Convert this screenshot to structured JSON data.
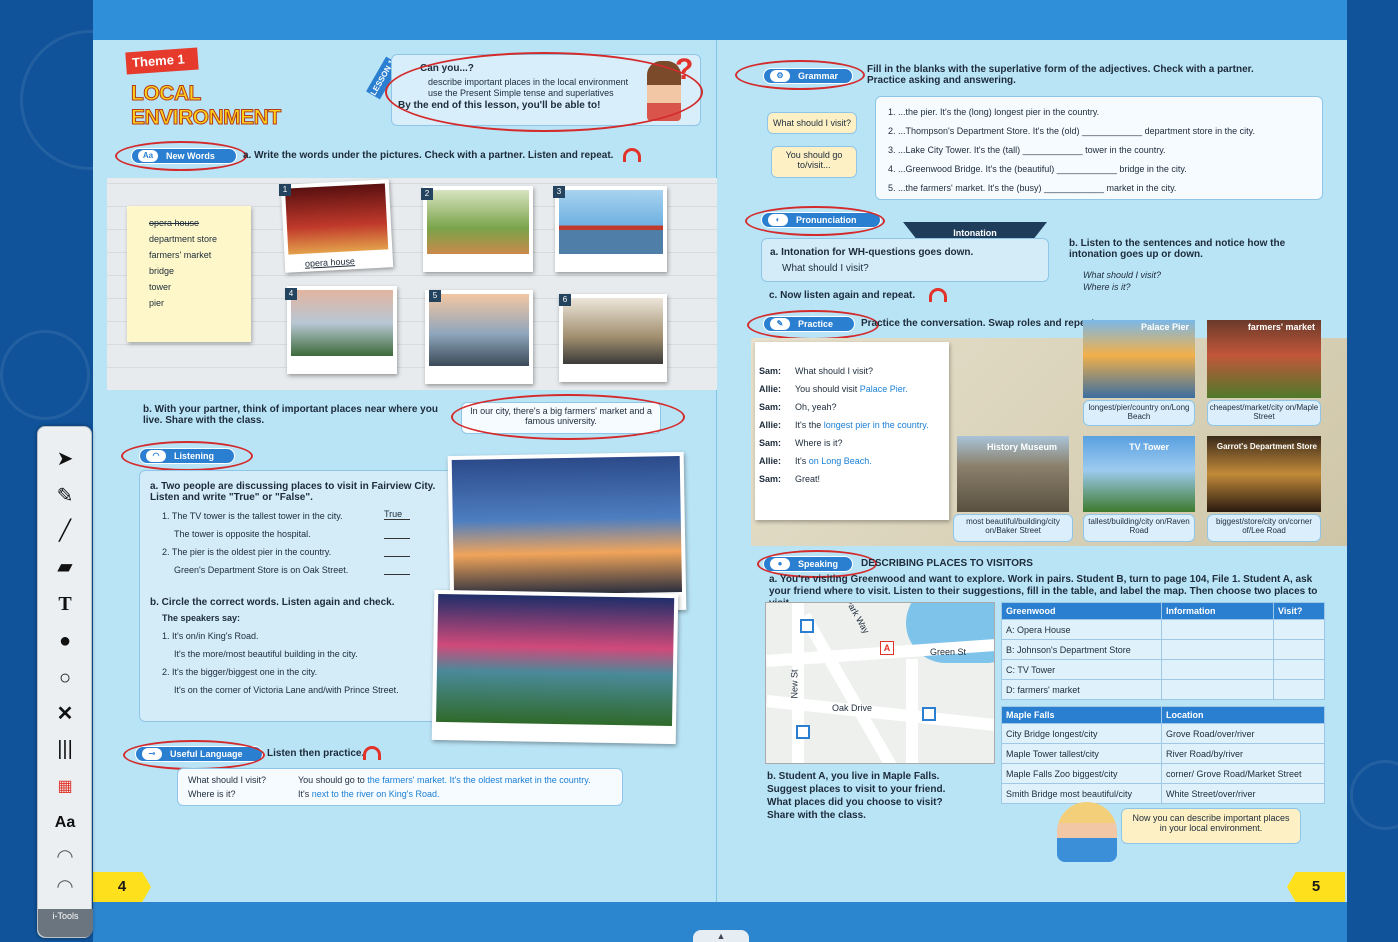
{
  "left_page": {
    "theme_badge": "Theme 1",
    "theme_title": "LOCAL ENVIRONMENT",
    "lesson_tag": "LESSON 1",
    "objectives": {
      "heading": "Can you...?",
      "items": [
        "describe important places in the local environment",
        "use the Present Simple tense and superlatives"
      ],
      "footer": "By the end of this lesson, you'll be able to!"
    },
    "new_words": {
      "label": "New Words",
      "instruction": "a. Write the words under the pictures. Check with a partner. Listen and repeat.",
      "word_list": [
        "opera house",
        "department store",
        "farmers' market",
        "bridge",
        "tower",
        "pier"
      ],
      "photo_numbers": [
        "1",
        "2",
        "3",
        "4",
        "5",
        "6"
      ],
      "photo1_caption": "opera house",
      "part_b": "b. With your partner, think of important places near where you live. Share with the class.",
      "speech": "In our city, there's a big farmers' market and a famous university."
    },
    "listening": {
      "label": "Listening",
      "part_a": "a. Two people are discussing places to visit in Fairview City. Listen and write \"True\" or \"False\".",
      "items": [
        {
          "text": "1. The TV tower is the tallest tower in the city.",
          "answer": "True"
        },
        {
          "text": "The tower is opposite the hospital.",
          "answer": ""
        },
        {
          "text": "2. The pier is the oldest pier in the country.",
          "answer": ""
        },
        {
          "text": "Green's Department Store is on Oak Street.",
          "answer": ""
        }
      ],
      "part_b": "b. Circle the correct words. Listen again and check.",
      "speakers": "The speakers say:",
      "b_items": [
        "1. It's on/in King's Road.",
        "It's the more/most beautiful building in the city.",
        "2. It's the bigger/biggest one in the city.",
        "It's on the corner of Victoria Lane and/with Prince Street."
      ]
    },
    "useful_language": {
      "label": "Useful Language",
      "instruction": "Listen then practice.",
      "q1": "What should I visit?",
      "q2": "Where is it?",
      "a1_start": "You should go to ",
      "a1_blue": "the farmers' market. It's the oldest market in the country.",
      "a2_start": "It's ",
      "a2_blue": "next to the river on King's Road."
    },
    "page_number": "4"
  },
  "right_page": {
    "grammar": {
      "label": "Grammar",
      "instruction": "Fill in the blanks with the superlative form of the adjectives. Check with a partner. Practice asking and answering.",
      "bubble1": "What should I visit?",
      "bubble2": "You should go to/visit...",
      "items": [
        "1. ...the pier. It's the (long) longest pier in the country.",
        "2. ...Thompson's Department Store. It's the (old) ____________ department store in the city.",
        "3. ...Lake City Tower. It's the (tall) ____________ tower in the country.",
        "4. ...Greenwood Bridge. It's the (beautiful) ____________ bridge in the city.",
        "5. ...the farmers' market. It's the (busy) ____________ market in the city."
      ]
    },
    "pronunciation": {
      "label": "Pronunciation",
      "intonation_tab": "Intonation",
      "a_title": "a. Intonation for WH-questions goes down.",
      "a_example": "What should I visit?",
      "b_text": "b. Listen to the sentences and notice how the intonation goes up or down.",
      "b_ex1": "What should I visit?",
      "b_ex2": "Where is it?",
      "c_text": "c. Now listen again and repeat."
    },
    "practice": {
      "label": "Practice",
      "instruction": "Practice the conversation. Swap roles and repeat.",
      "dialogue": [
        {
          "speaker": "Sam:",
          "line": "What should I visit?",
          "blue": ""
        },
        {
          "speaker": "Allie:",
          "line": "You should visit ",
          "blue": "Palace Pier."
        },
        {
          "speaker": "Sam:",
          "line": "Oh, yeah?",
          "blue": ""
        },
        {
          "speaker": "Allie:",
          "line": "It's the ",
          "blue": "longest pier in the country."
        },
        {
          "speaker": "Sam:",
          "line": "Where is it?",
          "blue": ""
        },
        {
          "speaker": "Allie:",
          "line": "It's ",
          "blue": "on Long Beach."
        },
        {
          "speaker": "Sam:",
          "line": "Great!",
          "blue": ""
        }
      ],
      "places": [
        {
          "name": "Palace Pier",
          "caption": "longest/pier/country on/Long Beach"
        },
        {
          "name": "farmers' market",
          "caption": "cheapest/market/city on/Maple Street"
        },
        {
          "name": "History Museum",
          "caption": "most beautiful/building/city on/Baker Street"
        },
        {
          "name": "TV Tower",
          "caption": "tallest/building/city on/Raven Road"
        },
        {
          "name": "Garrot's Department Store",
          "caption": "biggest/store/city on/corner of/Lee Road"
        }
      ]
    },
    "speaking": {
      "label": "Speaking",
      "title": "DESCRIBING PLACES TO VISITORS",
      "instruction": "a. You're visiting Greenwood and want to explore. Work in pairs. Student B, turn to page 104, File 1. Student A, ask your friend where to visit. Listen to their suggestions, fill in the table, and label the map. Then choose two places to visit.",
      "map_labels": [
        "Park Way",
        "Green St",
        "New St",
        "Oak Drive",
        "A"
      ],
      "table1_headers": [
        "Greenwood",
        "Information",
        "Visit?"
      ],
      "table1_rows": [
        "A: Opera House",
        "B: Johnson's Department Store",
        "C: TV Tower",
        "D: farmers' market"
      ],
      "table2_headers": [
        "Maple Falls",
        "Location"
      ],
      "table2_rows": [
        [
          "City Bridge longest/city",
          "Grove Road/over/river"
        ],
        [
          "Maple Tower tallest/city",
          "River Road/by/river"
        ],
        [
          "Maple Falls Zoo biggest/city",
          "corner/ Grove Road/Market Street"
        ],
        [
          "Smith Bridge most beautiful/city",
          "White Street/over/river"
        ]
      ],
      "part_b": "b. Student A, you live in Maple Falls. Suggest places to visit to your friend. What places did you choose to visit? Share with the class.",
      "closing_bubble": "Now you can describe important places in your local environment."
    },
    "page_number": "5"
  },
  "toolbar": {
    "label": "i-Tools",
    "text_tool": "T",
    "font_tool": "Aa"
  },
  "colors": {
    "page_bg": "#b9e4f6",
    "accent_blue": "#2a7fd0",
    "annotation_red": "#d32b2b",
    "page_tab_yellow": "#ffe01c"
  }
}
